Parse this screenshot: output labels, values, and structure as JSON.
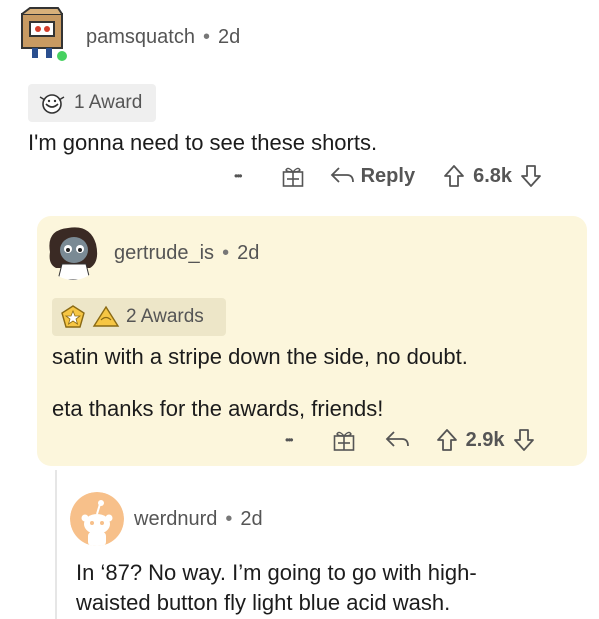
{
  "comments": [
    {
      "username": "pamsquatch",
      "separator": "•",
      "age": "2d",
      "awards_label": "1 Award",
      "text": "I'm gonna need to see these shorts.",
      "more": "•••",
      "reply_label": "Reply",
      "score": "6.8k"
    },
    {
      "username": "gertrude_is",
      "separator": "•",
      "age": "2d",
      "awards_label": "2 Awards",
      "text_1": "satin with a stripe down the side, no doubt.",
      "text_2": "eta thanks for the awards, friends!",
      "more": "•••",
      "score": "2.9k",
      "highlight_color": "#fcf6dc"
    },
    {
      "username": "werdnurd",
      "separator": "•",
      "age": "2d",
      "text_1": "In ‘87? No way. I’m going to go with high-",
      "text_2": "waisted button fly light blue acid wash."
    }
  ],
  "icons": {
    "online_indicator_color": "#46d160",
    "snoo_avatar_bg": "#f7c08a"
  }
}
